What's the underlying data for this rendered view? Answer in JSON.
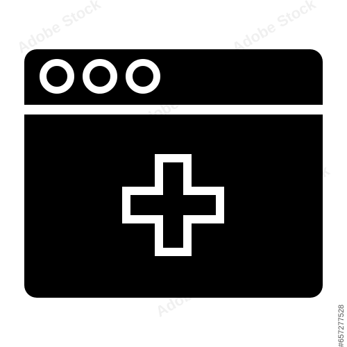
{
  "icon": {
    "name": "browser-window-medical-icon",
    "fill_color": "#000000",
    "cutout_color": "#ffffff"
  },
  "watermark": {
    "brand_text": "Adobe Stock",
    "stock_id": "#657277528"
  }
}
